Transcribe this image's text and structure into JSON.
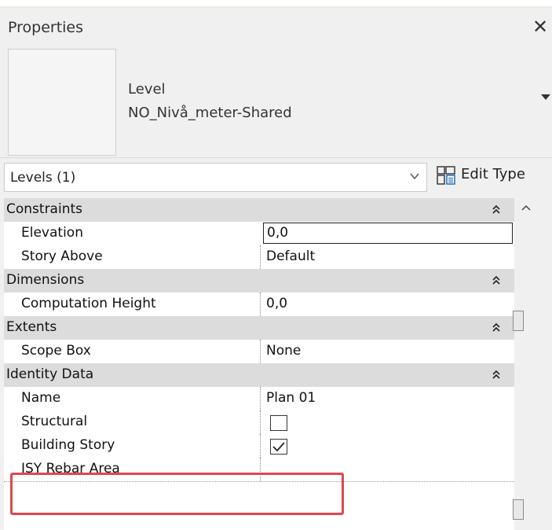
{
  "panel": {
    "title": "Properties",
    "close_glyph": "✕"
  },
  "type_selector": {
    "family": "Level",
    "type_name": "NO_Nivå_meter-Shared"
  },
  "instance_filter": {
    "label": "Levels (1)",
    "edit_type_label": "Edit Type"
  },
  "groups": [
    {
      "name": "Constraints",
      "properties": [
        {
          "name": "Elevation",
          "value": "0,0"
        },
        {
          "name": "Story Above",
          "value": "Default"
        }
      ]
    },
    {
      "name": "Dimensions",
      "properties": [
        {
          "name": "Computation Height",
          "value": "0,0"
        }
      ]
    },
    {
      "name": "Extents",
      "properties": [
        {
          "name": "Scope Box",
          "value": "None"
        }
      ]
    },
    {
      "name": "Identity Data",
      "properties": [
        {
          "name": "Name",
          "value": "Plan 01"
        },
        {
          "name": "Structural",
          "checked": false
        },
        {
          "name": "Building Story",
          "checked": true
        },
        {
          "name": "ISY Rebar Area",
          "value": ""
        }
      ]
    }
  ],
  "colors": {
    "highlight": "#e0474e",
    "category_bg": "#dcdcdc",
    "panel_bg": "#f0f0f0"
  },
  "icons": [
    "close-icon",
    "dropdown-arrow-icon",
    "chevron-down-icon",
    "edit-type-icon",
    "collapse-group-icon",
    "scroll-up-icon",
    "checkbox-checked-icon"
  ]
}
